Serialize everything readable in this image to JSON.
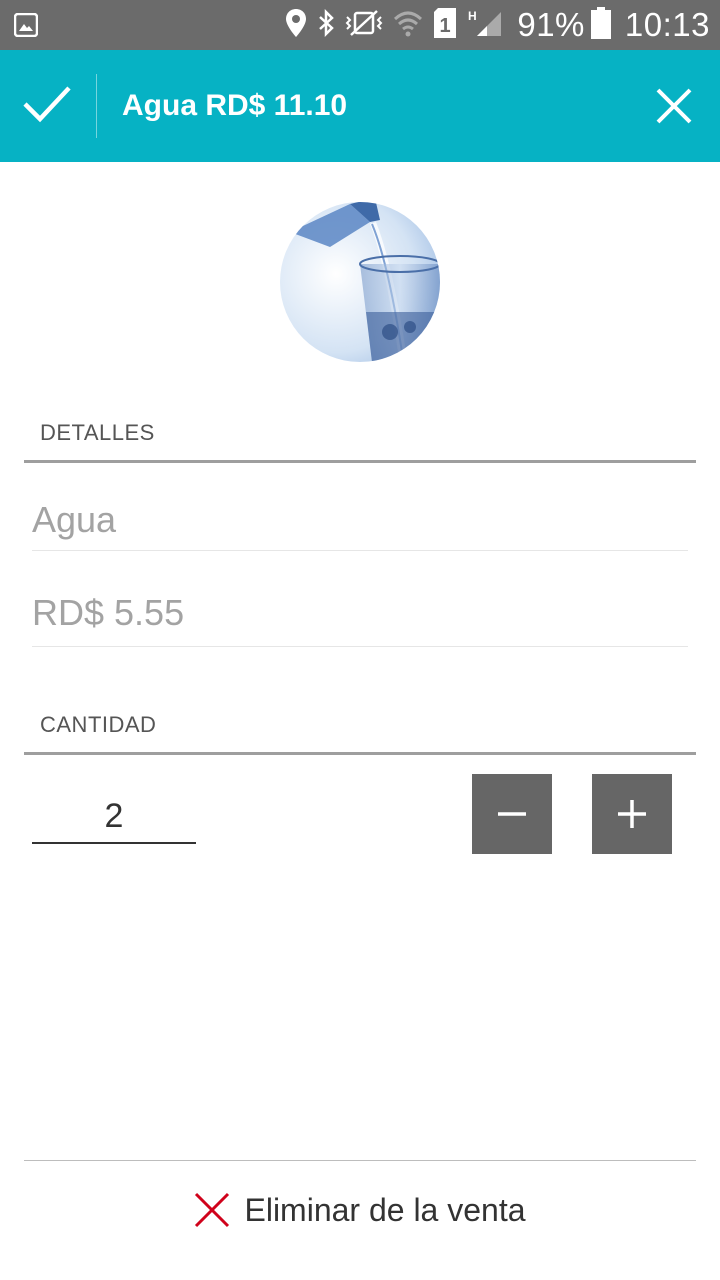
{
  "status_bar": {
    "battery": "91%",
    "time": "10:13",
    "sim_slot": "1",
    "network_type": "H",
    "icons": [
      "gallery-icon",
      "location-icon",
      "bluetooth-icon",
      "vibrate-mute-icon",
      "wifi-icon",
      "sim-icon",
      "signal-icon",
      "battery-icon"
    ]
  },
  "app_bar": {
    "title": "Agua RD$ 11.10",
    "background_color": "#06b2c4",
    "confirm_icon": "check-icon",
    "close_icon": "close-icon"
  },
  "product": {
    "image_icon": "water-glass-image"
  },
  "details": {
    "header": "DETALLES",
    "name_value": "Agua",
    "price_value": "RD$ 5.55"
  },
  "quantity": {
    "header": "CANTIDAD",
    "value": "2",
    "decrement_icon": "minus-icon",
    "increment_icon": "plus-icon"
  },
  "footer": {
    "delete_label": "Eliminar de la venta",
    "delete_icon": "close-icon",
    "delete_icon_color": "#d0021b"
  }
}
